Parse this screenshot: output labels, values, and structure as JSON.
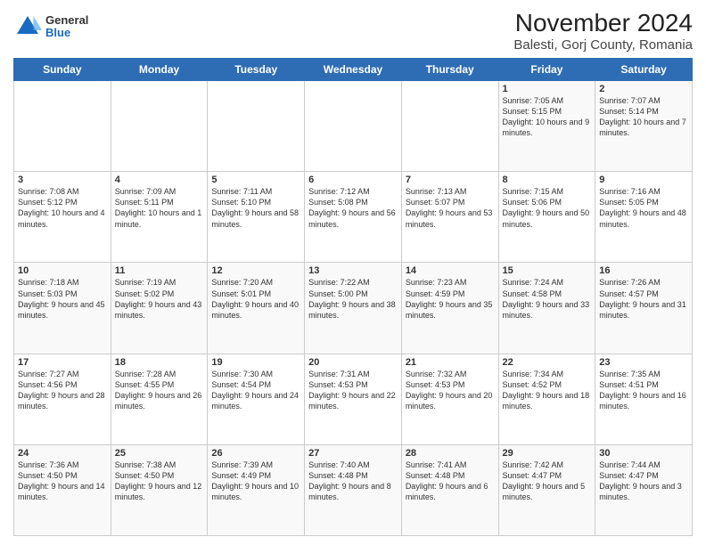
{
  "header": {
    "logo": {
      "general": "General",
      "blue": "Blue"
    },
    "title": "November 2024",
    "subtitle": "Balesti, Gorj County, Romania"
  },
  "weekdays": [
    "Sunday",
    "Monday",
    "Tuesday",
    "Wednesday",
    "Thursday",
    "Friday",
    "Saturday"
  ],
  "weeks": [
    [
      {
        "day": "",
        "info": ""
      },
      {
        "day": "",
        "info": ""
      },
      {
        "day": "",
        "info": ""
      },
      {
        "day": "",
        "info": ""
      },
      {
        "day": "",
        "info": ""
      },
      {
        "day": "1",
        "info": "Sunrise: 7:05 AM\nSunset: 5:15 PM\nDaylight: 10 hours and 9 minutes."
      },
      {
        "day": "2",
        "info": "Sunrise: 7:07 AM\nSunset: 5:14 PM\nDaylight: 10 hours and 7 minutes."
      }
    ],
    [
      {
        "day": "3",
        "info": "Sunrise: 7:08 AM\nSunset: 5:12 PM\nDaylight: 10 hours and 4 minutes."
      },
      {
        "day": "4",
        "info": "Sunrise: 7:09 AM\nSunset: 5:11 PM\nDaylight: 10 hours and 1 minute."
      },
      {
        "day": "5",
        "info": "Sunrise: 7:11 AM\nSunset: 5:10 PM\nDaylight: 9 hours and 58 minutes."
      },
      {
        "day": "6",
        "info": "Sunrise: 7:12 AM\nSunset: 5:08 PM\nDaylight: 9 hours and 56 minutes."
      },
      {
        "day": "7",
        "info": "Sunrise: 7:13 AM\nSunset: 5:07 PM\nDaylight: 9 hours and 53 minutes."
      },
      {
        "day": "8",
        "info": "Sunrise: 7:15 AM\nSunset: 5:06 PM\nDaylight: 9 hours and 50 minutes."
      },
      {
        "day": "9",
        "info": "Sunrise: 7:16 AM\nSunset: 5:05 PM\nDaylight: 9 hours and 48 minutes."
      }
    ],
    [
      {
        "day": "10",
        "info": "Sunrise: 7:18 AM\nSunset: 5:03 PM\nDaylight: 9 hours and 45 minutes."
      },
      {
        "day": "11",
        "info": "Sunrise: 7:19 AM\nSunset: 5:02 PM\nDaylight: 9 hours and 43 minutes."
      },
      {
        "day": "12",
        "info": "Sunrise: 7:20 AM\nSunset: 5:01 PM\nDaylight: 9 hours and 40 minutes."
      },
      {
        "day": "13",
        "info": "Sunrise: 7:22 AM\nSunset: 5:00 PM\nDaylight: 9 hours and 38 minutes."
      },
      {
        "day": "14",
        "info": "Sunrise: 7:23 AM\nSunset: 4:59 PM\nDaylight: 9 hours and 35 minutes."
      },
      {
        "day": "15",
        "info": "Sunrise: 7:24 AM\nSunset: 4:58 PM\nDaylight: 9 hours and 33 minutes."
      },
      {
        "day": "16",
        "info": "Sunrise: 7:26 AM\nSunset: 4:57 PM\nDaylight: 9 hours and 31 minutes."
      }
    ],
    [
      {
        "day": "17",
        "info": "Sunrise: 7:27 AM\nSunset: 4:56 PM\nDaylight: 9 hours and 28 minutes."
      },
      {
        "day": "18",
        "info": "Sunrise: 7:28 AM\nSunset: 4:55 PM\nDaylight: 9 hours and 26 minutes."
      },
      {
        "day": "19",
        "info": "Sunrise: 7:30 AM\nSunset: 4:54 PM\nDaylight: 9 hours and 24 minutes."
      },
      {
        "day": "20",
        "info": "Sunrise: 7:31 AM\nSunset: 4:53 PM\nDaylight: 9 hours and 22 minutes."
      },
      {
        "day": "21",
        "info": "Sunrise: 7:32 AM\nSunset: 4:53 PM\nDaylight: 9 hours and 20 minutes."
      },
      {
        "day": "22",
        "info": "Sunrise: 7:34 AM\nSunset: 4:52 PM\nDaylight: 9 hours and 18 minutes."
      },
      {
        "day": "23",
        "info": "Sunrise: 7:35 AM\nSunset: 4:51 PM\nDaylight: 9 hours and 16 minutes."
      }
    ],
    [
      {
        "day": "24",
        "info": "Sunrise: 7:36 AM\nSunset: 4:50 PM\nDaylight: 9 hours and 14 minutes."
      },
      {
        "day": "25",
        "info": "Sunrise: 7:38 AM\nSunset: 4:50 PM\nDaylight: 9 hours and 12 minutes."
      },
      {
        "day": "26",
        "info": "Sunrise: 7:39 AM\nSunset: 4:49 PM\nDaylight: 9 hours and 10 minutes."
      },
      {
        "day": "27",
        "info": "Sunrise: 7:40 AM\nSunset: 4:48 PM\nDaylight: 9 hours and 8 minutes."
      },
      {
        "day": "28",
        "info": "Sunrise: 7:41 AM\nSunset: 4:48 PM\nDaylight: 9 hours and 6 minutes."
      },
      {
        "day": "29",
        "info": "Sunrise: 7:42 AM\nSunset: 4:47 PM\nDaylight: 9 hours and 5 minutes."
      },
      {
        "day": "30",
        "info": "Sunrise: 7:44 AM\nSunset: 4:47 PM\nDaylight: 9 hours and 3 minutes."
      }
    ]
  ]
}
